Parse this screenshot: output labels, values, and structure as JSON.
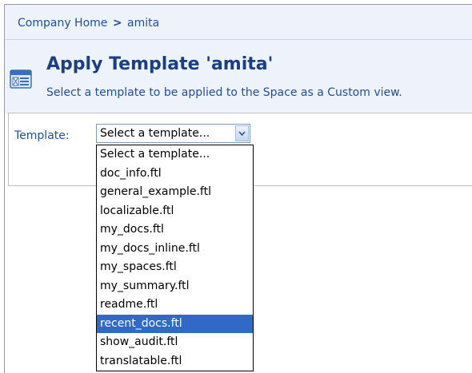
{
  "breadcrumb": {
    "root": "Company Home",
    "separator": ">",
    "current": "amita"
  },
  "header": {
    "icon": "template-view-icon",
    "title": "Apply Template 'amita'",
    "subtitle": "Select a template to be applied to the Space as a Custom view."
  },
  "form": {
    "template_label": "Template:",
    "selected_value": "Select a template...",
    "dropdown_icon": "chevron-down-icon"
  },
  "dropdown": {
    "items": [
      "Select a template...",
      "doc_info.ftl",
      "general_example.ftl",
      "localizable.ftl",
      "my_docs.ftl",
      "my_docs_inline.ftl",
      "my_spaces.ftl",
      "my_summary.ftl",
      "readme.ftl",
      "recent_docs.ftl",
      "show_audit.ftl",
      "translatable.ftl"
    ],
    "highlighted": "recent_docs.ftl"
  },
  "colors": {
    "panel_background": "#eef3fb",
    "link_blue": "#1f4fa0",
    "title_blue": "#1a3f86",
    "highlight": "#3169c6"
  }
}
